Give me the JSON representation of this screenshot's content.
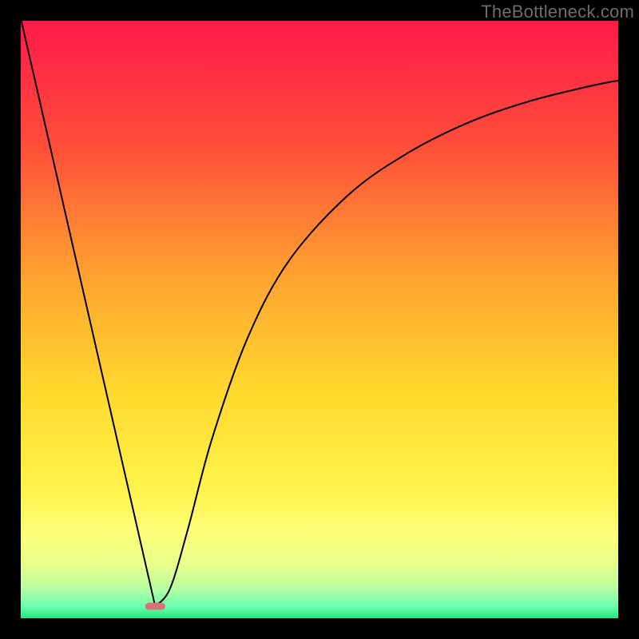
{
  "watermark": "TheBottleneck.com",
  "chart_data": {
    "type": "line",
    "title": "",
    "xlabel": "",
    "ylabel": "",
    "xlim": [
      0,
      100
    ],
    "ylim": [
      0,
      100
    ],
    "grid": false,
    "background_gradient": {
      "stops": [
        {
          "offset": 0,
          "color": "#ff1a4b"
        },
        {
          "offset": 20,
          "color": "#ff4b3a"
        },
        {
          "offset": 42,
          "color": "#ffa030"
        },
        {
          "offset": 62,
          "color": "#ffd92d"
        },
        {
          "offset": 78,
          "color": "#fff24a"
        },
        {
          "offset": 86,
          "color": "#fdff7a"
        },
        {
          "offset": 91,
          "color": "#e8ff8c"
        },
        {
          "offset": 95,
          "color": "#b6ffa0"
        },
        {
          "offset": 98,
          "color": "#6cffb0"
        },
        {
          "offset": 100,
          "color": "#22e77a"
        }
      ]
    },
    "curve": {
      "description": "Black V-shaped bottleneck curve; minimum near x≈22.5, left branch rises steeply to top-left corner, right branch is a decelerating curve rising toward upper right.",
      "points": [
        {
          "x": 0.1,
          "y": 100.0
        },
        {
          "x": 22.5,
          "y": 2.0
        },
        {
          "x": 25.0,
          "y": 5.0
        },
        {
          "x": 28.0,
          "y": 15.0
        },
        {
          "x": 32.0,
          "y": 30.0
        },
        {
          "x": 38.0,
          "y": 47.0
        },
        {
          "x": 45.0,
          "y": 60.0
        },
        {
          "x": 55.0,
          "y": 71.0
        },
        {
          "x": 65.0,
          "y": 78.0
        },
        {
          "x": 75.0,
          "y": 83.0
        },
        {
          "x": 85.0,
          "y": 86.5
        },
        {
          "x": 95.0,
          "y": 89.0
        },
        {
          "x": 100.0,
          "y": 90.0
        }
      ]
    },
    "marker": {
      "description": "Small rounded pink marker at curve minimum",
      "x": 22.5,
      "y": 2.0,
      "width_pct": 3.4,
      "height_pct": 1.2,
      "color": "#d9717a"
    }
  }
}
